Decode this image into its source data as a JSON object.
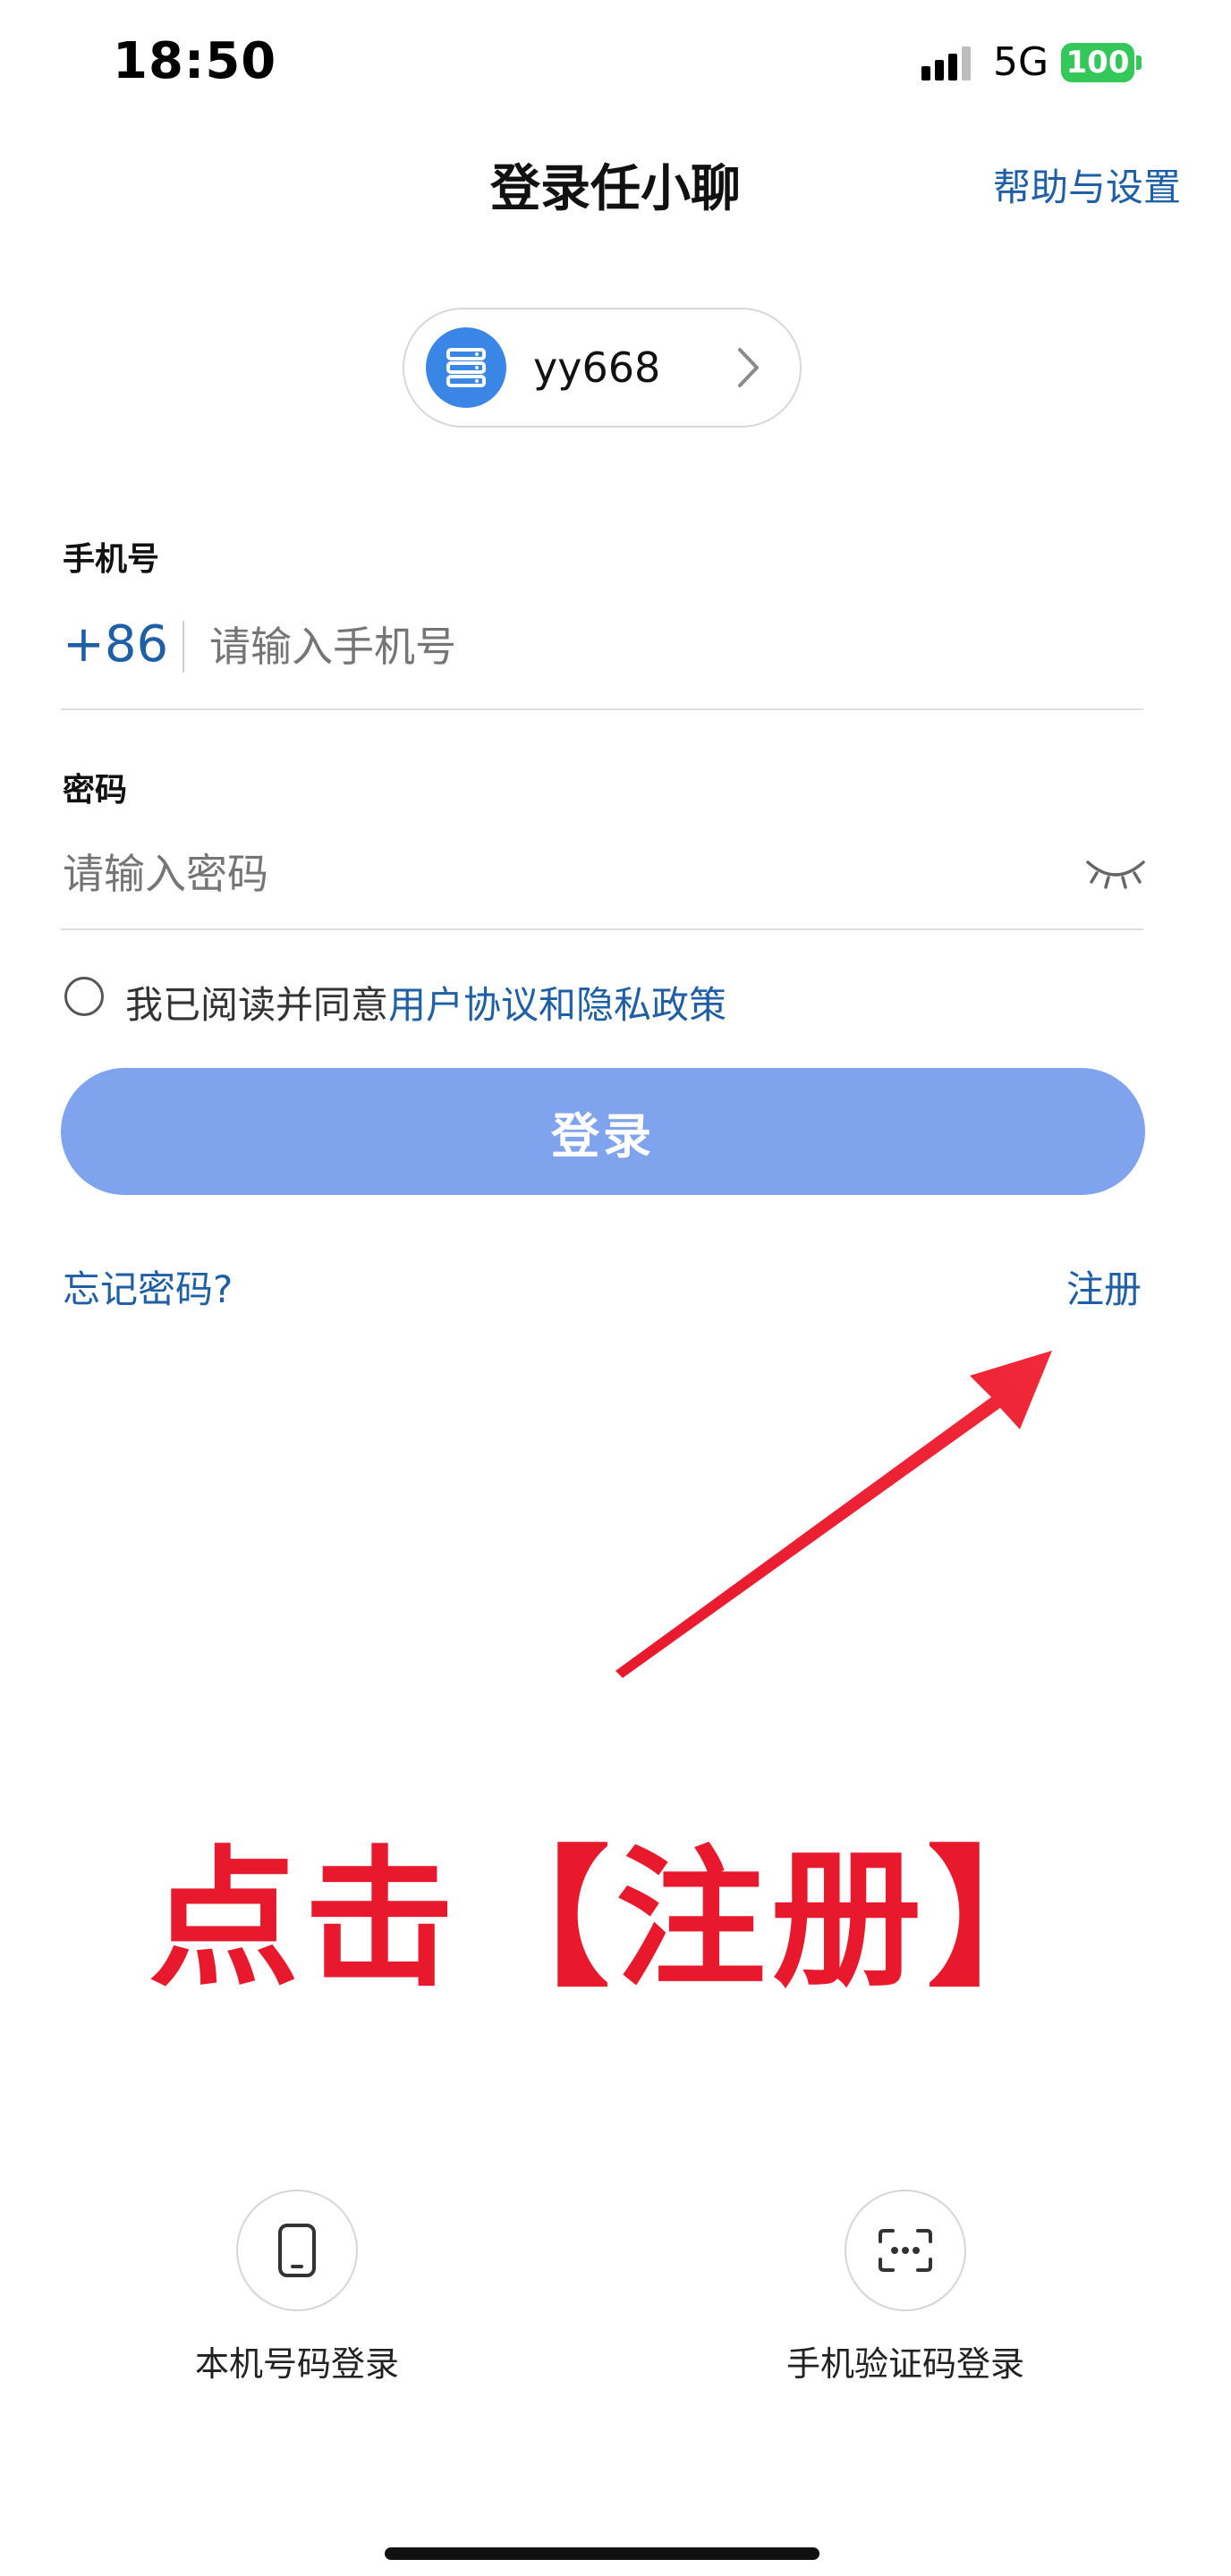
{
  "status_bar": {
    "time": "18:50",
    "network": "5G",
    "battery": "100"
  },
  "header": {
    "title": "登录任小聊",
    "help_link": "帮助与设置"
  },
  "server": {
    "name": "yy668",
    "icon": "server-icon"
  },
  "form": {
    "phone_label": "手机号",
    "country_code": "+86",
    "phone_placeholder": "请输入手机号",
    "password_label": "密码",
    "password_placeholder": "请输入密码",
    "password_toggle_icon": "eye-closed-icon"
  },
  "agreement": {
    "prefix": "我已阅读并同意",
    "link": "用户协议和隐私政策"
  },
  "login_button": "登录",
  "links": {
    "forgot_password": "忘记密码?",
    "register": "注册"
  },
  "annotation": {
    "text": "点击【注册】",
    "color": "#e8192c"
  },
  "alt_login": [
    {
      "label": "本机号码登录",
      "icon": "phone-icon"
    },
    {
      "label": "手机验证码登录",
      "icon": "sms-code-icon"
    }
  ],
  "colors": {
    "accent": "#1f5fa6",
    "button": "#7fa3ec",
    "battery": "#34c759"
  }
}
